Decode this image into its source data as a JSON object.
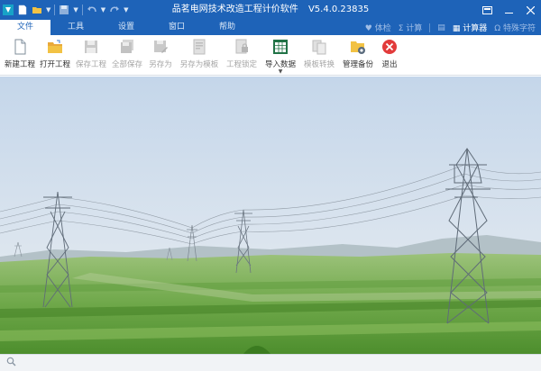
{
  "window": {
    "title_name": "品茗电网技术改造工程计价软件",
    "title_version": "V5.4.0.23835"
  },
  "quick_access": {
    "icons": [
      "app-logo-icon",
      "new-file-icon",
      "open-folder-icon",
      "save-icon",
      "undo-icon",
      "redo-icon"
    ]
  },
  "tabs": [
    {
      "label": "文件",
      "active": true
    },
    {
      "label": "工具",
      "active": false
    },
    {
      "label": "设置",
      "active": false
    },
    {
      "label": "窗口",
      "active": false
    },
    {
      "label": "帮助",
      "active": false
    }
  ],
  "tab_tools": {
    "check": "体检",
    "sum": "计算",
    "calculator": "计算器",
    "special_chars": "特殊字符"
  },
  "ribbon": [
    {
      "label": "新建工程",
      "icon": "new-project-icon",
      "disabled": false
    },
    {
      "label": "打开工程",
      "icon": "open-project-icon",
      "disabled": false
    },
    {
      "label": "保存工程",
      "icon": "save-project-icon",
      "disabled": true
    },
    {
      "label": "全部保存",
      "icon": "save-all-icon",
      "disabled": true
    },
    {
      "label": "另存为",
      "icon": "save-as-icon",
      "disabled": true
    },
    {
      "label": "另存为模板",
      "icon": "save-as-template-icon",
      "disabled": true
    },
    {
      "label": "工程锁定",
      "icon": "lock-project-icon",
      "disabled": true
    },
    {
      "label": "导入数据",
      "icon": "import-data-icon",
      "disabled": false,
      "dropdown": true
    },
    {
      "label": "模板转换",
      "icon": "template-convert-icon",
      "disabled": true
    },
    {
      "label": "管理备份",
      "icon": "manage-backup-icon",
      "disabled": false
    },
    {
      "label": "退出",
      "icon": "exit-icon",
      "disabled": false
    }
  ],
  "colors": {
    "title_blue": "#1e63b8",
    "exit_red": "#e23b3b",
    "folder_yellow": "#f2c244",
    "excel_green": "#217346"
  },
  "status": {
    "search_icon": "search-icon"
  }
}
